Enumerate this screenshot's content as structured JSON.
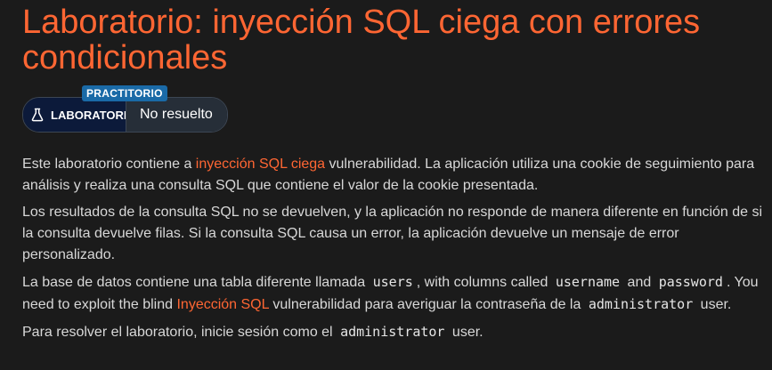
{
  "page": {
    "title": "Laboratorio: inyección SQL ciega con errores condicionales"
  },
  "lab_badge": {
    "level": "PRACTITORIO",
    "label": "LABORATORIO",
    "status": "No resuelto",
    "icon": "flask-icon"
  },
  "description": {
    "p1_before": "Este laboratorio contiene a ",
    "p1_link": "inyección SQL ciega",
    "p1_after": " vulnerabilidad. La aplicación utiliza una cookie de seguimiento para análisis y realiza una consulta SQL que contiene el valor de la cookie presentada.",
    "p2": "Los resultados de la consulta SQL no se devuelven, y la aplicación no responde de manera diferente en función de si la consulta devuelve filas. Si la consulta SQL causa un error, la aplicación devuelve un mensaje de error personalizado.",
    "p3_a": "La base de datos contiene una tabla diferente llamada ",
    "p3_code_table": "users",
    "p3_b": ", with columns called ",
    "p3_code_user": "username",
    "p3_c": " and ",
    "p3_code_pass": "password",
    "p3_d": ". You need to exploit the blind ",
    "p3_link": "Inyección SQL",
    "p3_e": " vulnerabilidad para averiguar la contraseña de la ",
    "p3_code_admin": "administrator",
    "p3_f": " user.",
    "p4_a": "Para resolver el laboratorio, inicie sesión como el ",
    "p4_code_admin": "administrator",
    "p4_b": " user."
  },
  "colors": {
    "accent": "#ff6633",
    "background": "#1b1b1b",
    "level_tag": "#1a6aa7",
    "badge_dark": "#0c1a3a"
  }
}
